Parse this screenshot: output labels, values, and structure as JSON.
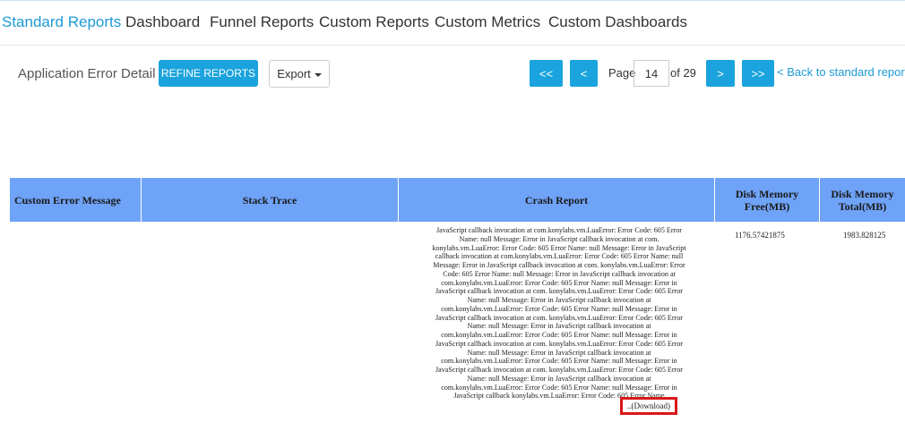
{
  "nav": {
    "tabs": [
      {
        "label": "Standard Reports",
        "active": true
      },
      {
        "label": "Dashboard"
      },
      {
        "label": "Funnel Reports"
      },
      {
        "label": "Custom Reports"
      },
      {
        "label": "Custom Metrics"
      },
      {
        "label": "Custom Dashboards"
      }
    ]
  },
  "toolbar": {
    "title": "Application Error Detail",
    "refine_label": "REFINE REPORTS",
    "export_label": "Export"
  },
  "pagination": {
    "first_label": "<<",
    "prev_label": "<",
    "page_label": "Page",
    "current_page": "14",
    "of_label": "of 29",
    "next_label": ">",
    "last_label": ">>",
    "back_link": "< Back to standard reports"
  },
  "table": {
    "headers": [
      "Custom Error Message",
      "Stack Trace",
      "Crash Report",
      "Disk Memory Free(MB)",
      "Disk Memory Total(MB)"
    ],
    "row": {
      "custom_error_message": "",
      "stack_trace": "",
      "crash_report": "JavaScript callback invocation at com.konylabs.vm.LuaError: Error Code: 605 Error Name: null Message: Error in JavaScript callback invocation at com. konylabs.vm.LuaError: Error Code: 605 Error Name: null Message: Error in JavaScript callback invocation at com.konylabs.vm.LuaError: Error Code: 605 Error Name: null Message: Error in JavaScript callback invocation at com. konylabs.vm.LuaError: Error Code: 605 Error Name: null Message: Error in JavaScript callback invocation at com.konylabs.vm.LuaError: Error Code: 605 Error Name: null Message: Error in JavaScript callback invocation at com. konylabs.vm.LuaError: Error Code: 605 Error Name: null Message: Error in JavaScript callback invocation at com.konylabs.vm.LuaError: Error Code: 605 Error Name: null Message: Error in JavaScript callback invocation at com. konylabs.vm.LuaError: Error Code: 605 Error Name: null Message: Error in JavaScript callback invocation at com.konylabs.vm.LuaError: Error Code: 605 Error Name: null Message: Error in JavaScript callback invocation at com. konylabs.vm.LuaError: Error Code: 605 Error Name: null Message: Error in JavaScript callback invocation at com.konylabs.vm.LuaError: Error Code: 605 Error Name: null Message: Error in JavaScript callback invocation at com. konylabs.vm.LuaError: Error Code: 605 Error Name: null Message: Error in JavaScript callback invocation at com.konylabs.vm.LuaError: Error Code: 605 Error Name: null Message: Error in JavaScript callback konylabs.vm.LuaError: Error Code: 605 Error Name",
      "download_label": "..(Download)",
      "disk_free": "1176.57421875",
      "disk_total": "1983.828125"
    }
  },
  "colors": {
    "accent": "#1aa3dd",
    "header_bg": "#6fa3f7",
    "highlight": "#d81818"
  }
}
